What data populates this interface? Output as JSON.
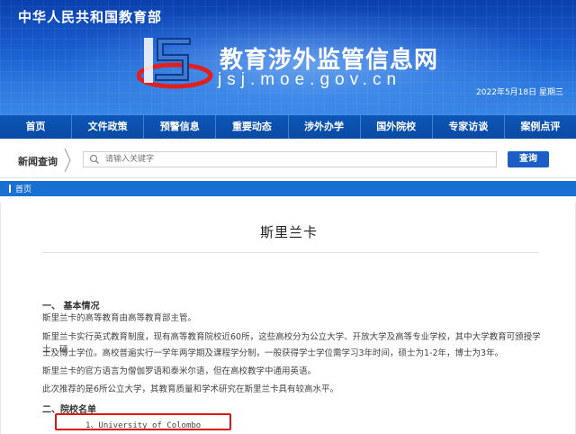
{
  "header": {
    "ministry": "中华人民共和国教育部",
    "site_title": "教育涉外监管信息网",
    "site_domain": "jsj.moe.gov.cn",
    "date": "2022年5月18日 星期三"
  },
  "nav": {
    "items": [
      "首页",
      "文件政策",
      "预警信息",
      "重要动态",
      "涉外办学",
      "国外院校",
      "专家访谈",
      "案例点评"
    ]
  },
  "search": {
    "label": "新闻查询",
    "placeholder": "请输入关键字",
    "button_label": "查询"
  },
  "breadcrumb": {
    "home": "首页"
  },
  "article": {
    "title": "斯里兰卡",
    "section1_heading": "一、 基本情况",
    "p1": "斯里兰卡的高等教育由高等教育部主管。",
    "p2_line1": "斯里兰卡实行英式教育制度，现有高等教育院校近60所，这些高校分为公立大学、开放大学及高等专业学校，其中大学教育可颁授学士、硕",
    "p2_line2": "士及博士学位。高校普遍实行一学年两学期及课程学分制，一般获得学士学位需学习3年时间，硕士为1-2年，博士为3年。",
    "p3": "斯里兰卡的官方语言为僧伽罗语和泰米尔语，但在高校教学中通用英语。",
    "p4": "此次推荐的是6所公立大学，其教育质量和学术研究在斯里兰卡具有较高水平。",
    "section2_heading": "二、院校名单",
    "school_1": "1、University of Colombo"
  },
  "colors": {
    "brand_blue": "#0d56b8",
    "breadcrumb_blue": "#1870d2",
    "highlight_red": "#e01515"
  }
}
